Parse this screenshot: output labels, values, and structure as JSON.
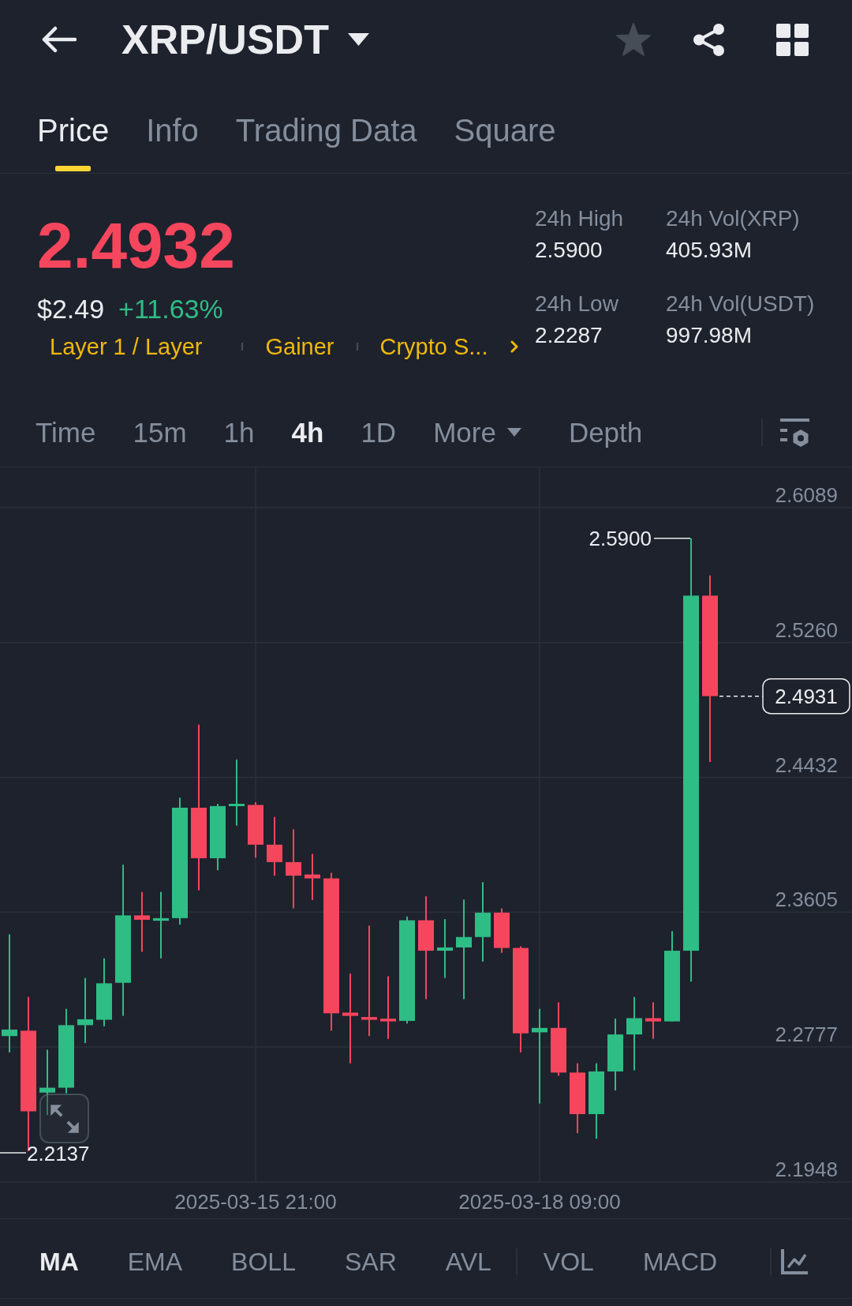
{
  "header": {
    "title": "XRP/USDT",
    "favorite": false
  },
  "tabs": [
    {
      "label": "Price",
      "selected": true
    },
    {
      "label": "Info",
      "selected": false
    },
    {
      "label": "Trading Data",
      "selected": false
    },
    {
      "label": "Square",
      "selected": false
    }
  ],
  "ticker": {
    "last_price": "2.4932",
    "price_up": false,
    "usd_price": "$2.49",
    "change": "+11.63%",
    "change_up": true,
    "tags": [
      "Layer 1 / Layer",
      "Gainer",
      "Crypto S..."
    ],
    "stats": [
      {
        "label": "24h High",
        "value": "2.5900"
      },
      {
        "label": "24h Vol(XRP)",
        "value": "405.93M"
      },
      {
        "label": "24h Low",
        "value": "2.2287"
      },
      {
        "label": "24h Vol(USDT)",
        "value": "997.98M"
      }
    ]
  },
  "intervals": [
    {
      "label": "Time",
      "kind": "option",
      "selected": false
    },
    {
      "label": "15m",
      "kind": "option",
      "selected": false
    },
    {
      "label": "1h",
      "kind": "option",
      "selected": false
    },
    {
      "label": "4h",
      "kind": "option",
      "selected": true
    },
    {
      "label": "1D",
      "kind": "option",
      "selected": false
    },
    {
      "label": "More",
      "kind": "dropdown",
      "selected": false
    },
    {
      "label": "Depth",
      "kind": "option",
      "selected": false
    }
  ],
  "chart": {
    "high_label": "2.5900",
    "last_price_tag": "2.4931",
    "low_label": "2.2137",
    "chart_data": {
      "type": "candlestick",
      "categories": [
        null,
        null,
        null,
        null,
        null,
        null,
        null,
        null,
        null,
        null,
        null,
        null,
        null,
        "2025-03-15 21:00",
        null,
        null,
        null,
        null,
        null,
        null,
        null,
        null,
        null,
        null,
        null,
        null,
        null,
        null,
        "2025-03-18 09:00",
        null,
        null,
        null,
        null,
        null,
        null,
        null,
        null,
        null
      ],
      "ohlc": [
        [
          2.2844,
          2.3468,
          2.2744,
          2.2884
        ],
        [
          2.2877,
          2.3084,
          2.2137,
          2.2382
        ],
        [
          2.2497,
          2.276,
          2.236,
          2.2527
        ],
        [
          2.2527,
          2.3011,
          2.2493,
          2.2911
        ],
        [
          2.2911,
          2.3201,
          2.2801,
          2.2947
        ],
        [
          2.2944,
          2.3321,
          2.2904,
          2.3168
        ],
        [
          2.3171,
          2.3896,
          2.2968,
          2.3585
        ],
        [
          2.3585,
          2.3729,
          2.3361,
          2.3558
        ],
        [
          2.3552,
          2.3729,
          2.3321,
          2.3568
        ],
        [
          2.3568,
          2.4307,
          2.3528,
          2.4246
        ],
        [
          2.4246,
          2.4756,
          2.3739,
          2.3936
        ],
        [
          2.3936,
          2.427,
          2.3862,
          2.4256
        ],
        [
          2.4256,
          2.4542,
          2.4136,
          2.427
        ],
        [
          2.4263,
          2.428,
          2.3939,
          2.4019
        ],
        [
          2.4019,
          2.4189,
          2.3829,
          2.3912
        ],
        [
          2.3912,
          2.4113,
          2.3628,
          2.3829
        ],
        [
          2.3836,
          2.3962,
          2.3679,
          2.3812
        ],
        [
          2.3812,
          2.3846,
          2.2877,
          2.2984
        ],
        [
          2.2988,
          2.3228,
          2.2677,
          2.2968
        ],
        [
          2.2961,
          2.3522,
          2.2844,
          2.2944
        ],
        [
          2.2951,
          2.3211,
          2.2827,
          2.2934
        ],
        [
          2.2937,
          2.3578,
          2.2921,
          2.3555
        ],
        [
          2.3555,
          2.3702,
          2.3071,
          2.3368
        ],
        [
          2.3368,
          2.3562,
          2.3201,
          2.3388
        ],
        [
          2.3388,
          2.3682,
          2.3071,
          2.3452
        ],
        [
          2.3452,
          2.3789,
          2.3301,
          2.3602
        ],
        [
          2.3602,
          2.3628,
          2.3355,
          2.3385
        ],
        [
          2.3385,
          2.3395,
          2.2744,
          2.2861
        ],
        [
          2.2867,
          2.3011,
          2.243,
          2.2894
        ],
        [
          2.2894,
          2.3051,
          2.26,
          2.262
        ],
        [
          2.262,
          2.2677,
          2.2248,
          2.2365
        ],
        [
          2.2365,
          2.2677,
          2.2214,
          2.2627
        ],
        [
          2.2627,
          2.2951,
          2.251,
          2.2854
        ],
        [
          2.2854,
          2.3084,
          2.2634,
          2.2954
        ],
        [
          2.2954,
          2.3051,
          2.2827,
          2.2934
        ],
        [
          2.2934,
          2.3488,
          2.2934,
          2.3368
        ],
        [
          2.3368,
          2.59,
          2.3178,
          2.5548
        ],
        [
          2.5548,
          2.5672,
          2.4527,
          2.4931
        ]
      ],
      "ylim": [
        2.1948,
        2.6335
      ],
      "yticks": [
        2.6089,
        {
          "value": 2.526,
          "label": "2.5260"
        },
        2.4432,
        2.3605,
        2.2777,
        2.1948
      ]
    }
  },
  "indicators": {
    "main": [
      {
        "label": "MA",
        "selected": true
      },
      {
        "label": "EMA",
        "selected": false
      },
      {
        "label": "BOLL",
        "selected": false
      },
      {
        "label": "SAR",
        "selected": false
      },
      {
        "label": "AVL",
        "selected": false
      }
    ],
    "sub": [
      {
        "label": "VOL",
        "selected": false
      },
      {
        "label": "MACD",
        "selected": false
      }
    ]
  }
}
